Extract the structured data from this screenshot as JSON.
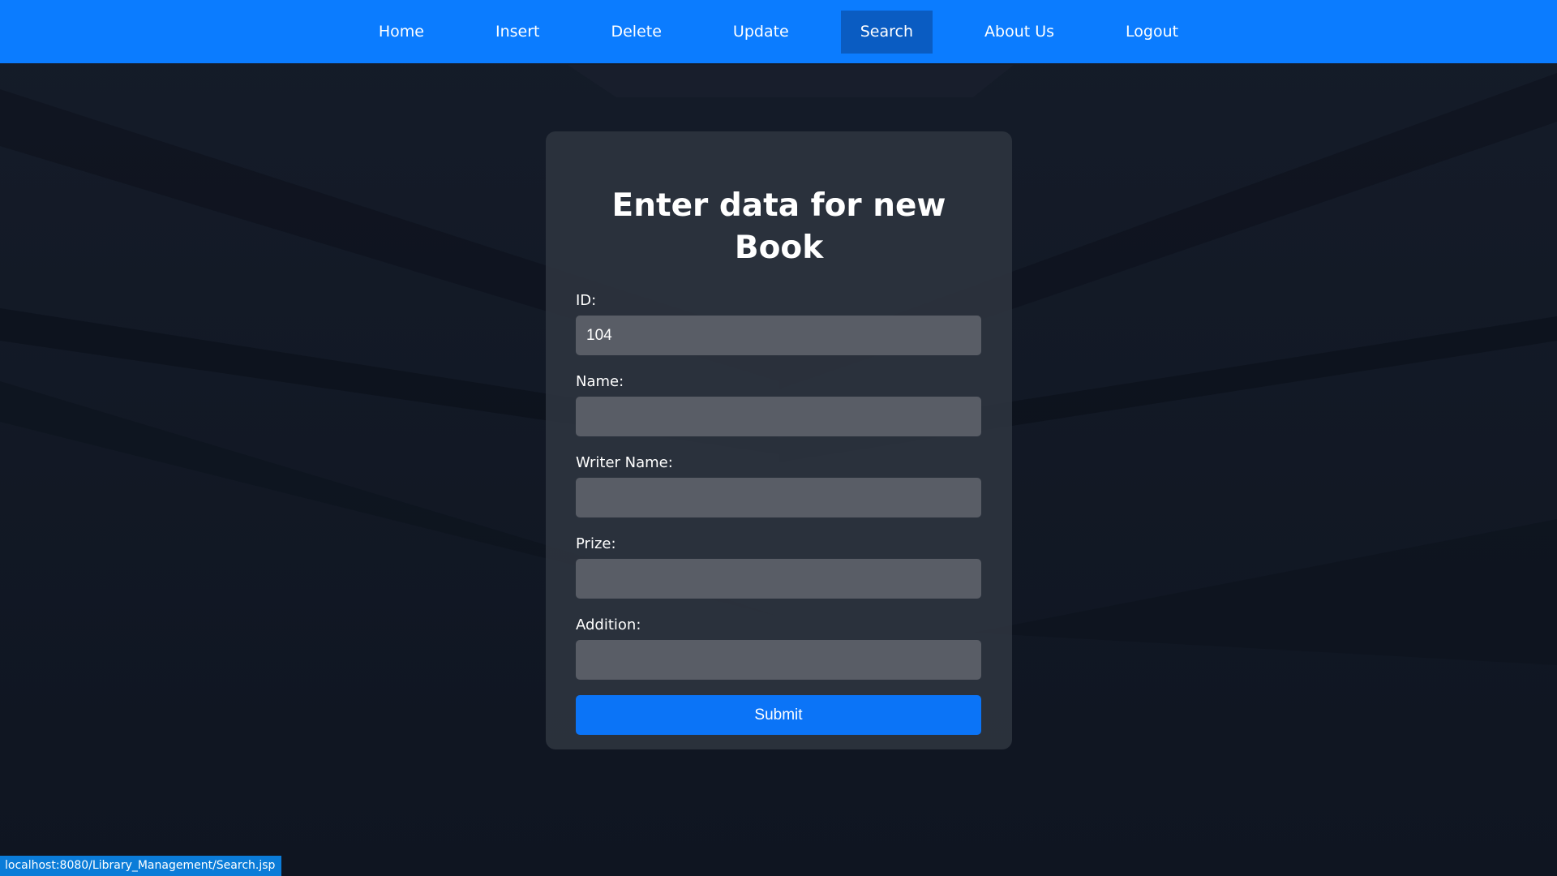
{
  "nav": {
    "items": [
      {
        "label": "Home"
      },
      {
        "label": "Insert"
      },
      {
        "label": "Delete"
      },
      {
        "label": "Update"
      },
      {
        "label": "Search",
        "active": true
      },
      {
        "label": "About Us"
      },
      {
        "label": "Logout"
      }
    ]
  },
  "form": {
    "title": "Enter data for new Book",
    "fields": [
      {
        "label": "ID:",
        "value": "104"
      },
      {
        "label": "Name:",
        "value": ""
      },
      {
        "label": "Writer Name:",
        "value": ""
      },
      {
        "label": "Prize:",
        "value": ""
      },
      {
        "label": "Addition:",
        "value": ""
      }
    ],
    "submit_label": "Submit"
  },
  "status_bar": {
    "url": "localhost:8080/Library_Management/Search.jsp"
  },
  "colors": {
    "nav_bg": "#0b7cff",
    "nav_active": "#0a5cc2",
    "submit_bg": "#0b74f7",
    "page_bg": "#111826"
  }
}
